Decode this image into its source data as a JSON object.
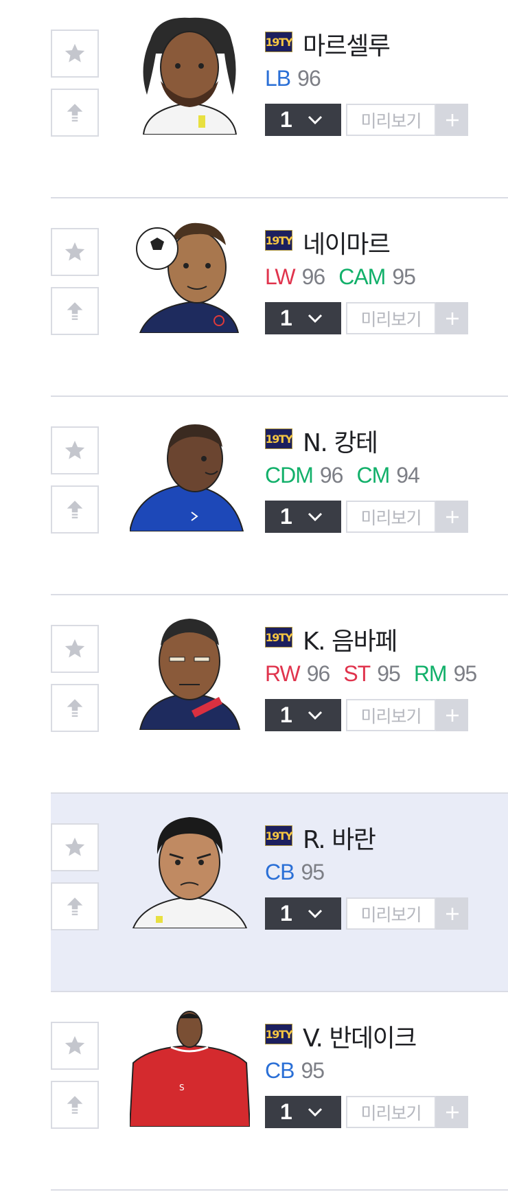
{
  "players": [
    {
      "season": "19TY",
      "name": "마르셀루",
      "positions": [
        {
          "pos": "LB",
          "ovr": "96",
          "color": "#2a6fd6"
        }
      ],
      "quantity": "1",
      "preview_label": "미리보기",
      "highlighted": false
    },
    {
      "season": "19TY",
      "name": "네이마르",
      "positions": [
        {
          "pos": "LW",
          "ovr": "96",
          "color": "#e0344d"
        },
        {
          "pos": "CAM",
          "ovr": "95",
          "color": "#12b06a"
        }
      ],
      "quantity": "1",
      "preview_label": "미리보기",
      "highlighted": false
    },
    {
      "season": "19TY",
      "name": "N. 캉테",
      "positions": [
        {
          "pos": "CDM",
          "ovr": "96",
          "color": "#12b06a"
        },
        {
          "pos": "CM",
          "ovr": "94",
          "color": "#12b06a"
        }
      ],
      "quantity": "1",
      "preview_label": "미리보기",
      "highlighted": false
    },
    {
      "season": "19TY",
      "name": "K. 음바페",
      "positions": [
        {
          "pos": "RW",
          "ovr": "96",
          "color": "#e0344d"
        },
        {
          "pos": "ST",
          "ovr": "95",
          "color": "#e0344d"
        },
        {
          "pos": "RM",
          "ovr": "95",
          "color": "#12b06a"
        }
      ],
      "quantity": "1",
      "preview_label": "미리보기",
      "highlighted": false
    },
    {
      "season": "19TY",
      "name": "R. 바란",
      "positions": [
        {
          "pos": "CB",
          "ovr": "95",
          "color": "#2a6fd6"
        }
      ],
      "quantity": "1",
      "preview_label": "미리보기",
      "highlighted": true
    },
    {
      "season": "19TY",
      "name": "V. 반데이크",
      "positions": [
        {
          "pos": "CB",
          "ovr": "95",
          "color": "#2a6fd6"
        }
      ],
      "quantity": "1",
      "preview_label": "미리보기",
      "highlighted": false
    }
  ],
  "icons": {
    "favorite": "star-icon",
    "upgrade": "arrow-up-icon",
    "dropdown": "chevron-down-icon",
    "add": "plus-icon"
  },
  "colors": {
    "select_bg": "#3a3d45",
    "highlight_row": "#e9ecf7",
    "badge_bg": "#1c1f5e",
    "badge_text": "#f4c542"
  }
}
